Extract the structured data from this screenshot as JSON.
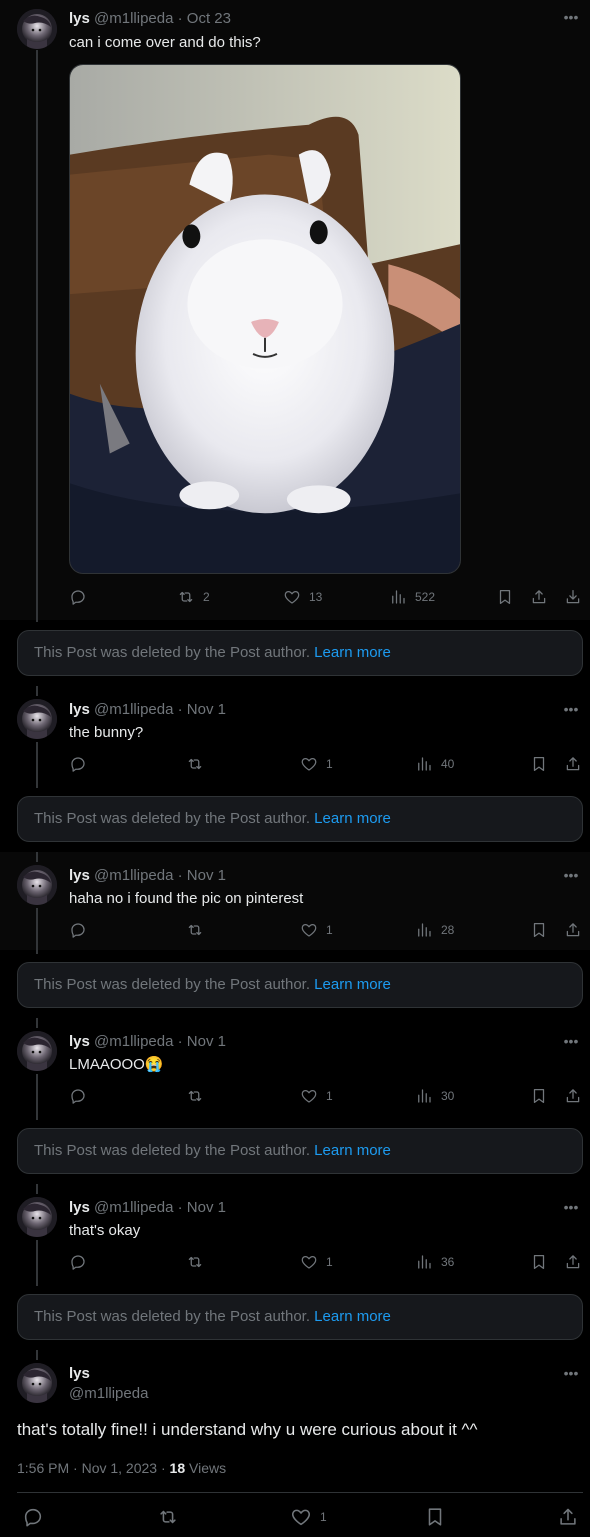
{
  "author": {
    "name": "lys",
    "handle": "@m1llipeda"
  },
  "replies": [
    {
      "date": "· Oct 23",
      "text": "can i come over and do this?",
      "retweets": "2",
      "likes": "13",
      "views": "522",
      "has_image": true
    },
    {
      "date": "· Nov 1",
      "text": "the bunny?",
      "retweets": "",
      "likes": "1",
      "views": "40"
    },
    {
      "date": "· Nov 1",
      "text": "haha no i found the pic on pinterest",
      "retweets": "",
      "likes": "1",
      "views": "28"
    },
    {
      "date": "· Nov 1",
      "text": "LMAAOOO😭",
      "retweets": "",
      "likes": "1",
      "views": "30"
    },
    {
      "date": "· Nov 1",
      "text": "that's okay",
      "retweets": "",
      "likes": "1",
      "views": "36"
    }
  ],
  "deleted_notice": {
    "text": "This Post was deleted by the Post author.",
    "link": "Learn more"
  },
  "main_post": {
    "text": "that's totally fine!! i understand why u were curious about it ^^",
    "time": "1:56 PM · Nov 1, 2023 ·",
    "views_count": "18",
    "views_label": "Views",
    "likes": "1"
  },
  "icons": {
    "more": "more-icon",
    "reply": "reply-icon",
    "retweet": "retweet-icon",
    "like": "heart-icon",
    "views": "views-icon",
    "bookmark": "bookmark-icon",
    "share": "share-icon",
    "download": "download-icon"
  },
  "colors": {
    "background": "#000000",
    "text": "#e7e9ea",
    "muted": "#71767b",
    "link": "#1d9bf0",
    "card": "#16181c"
  }
}
